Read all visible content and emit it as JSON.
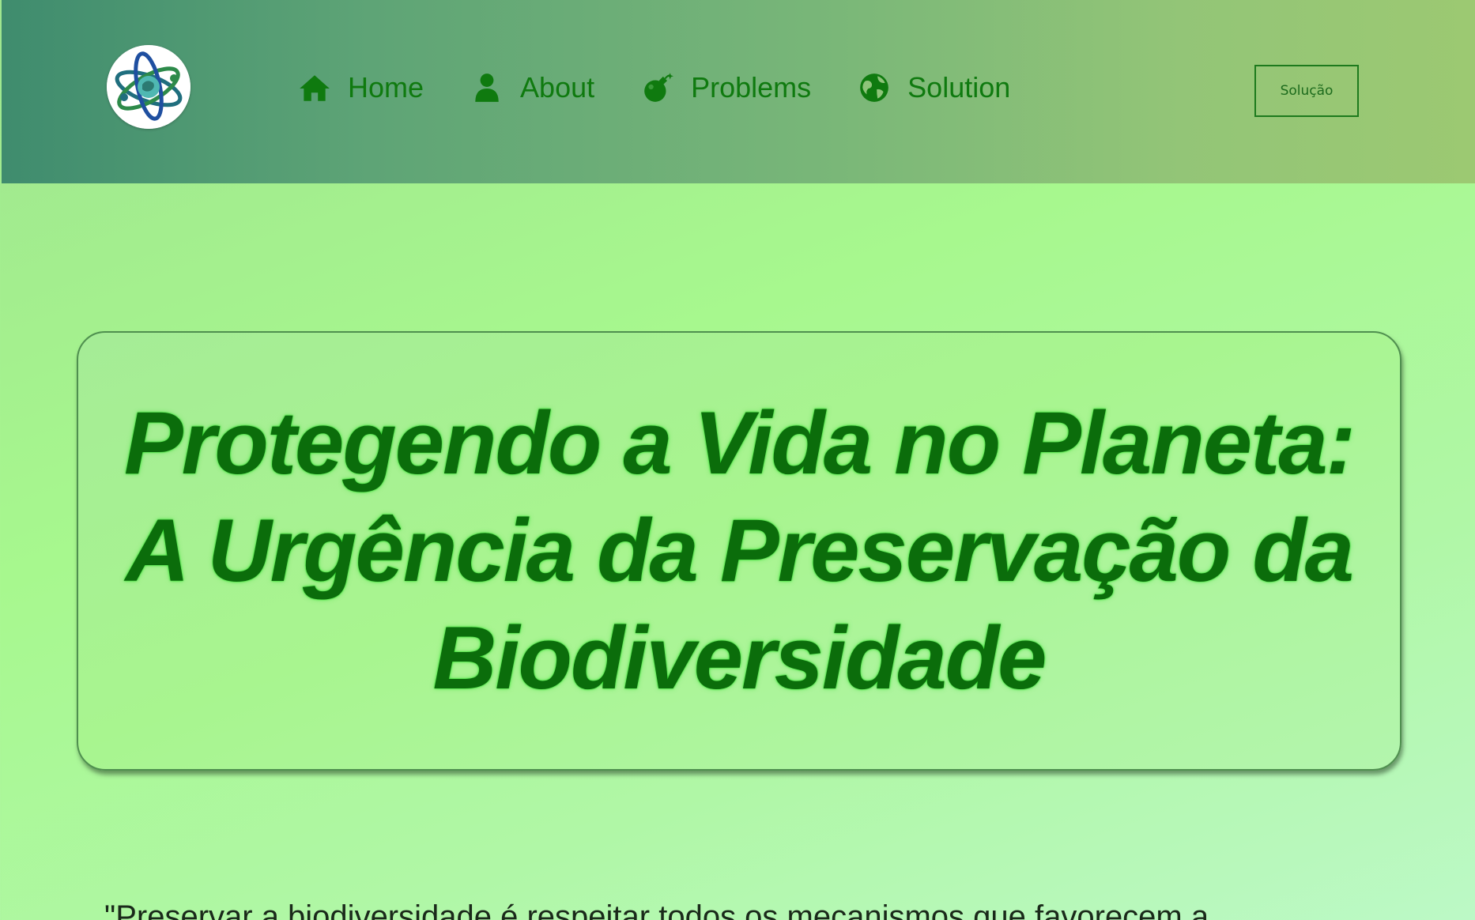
{
  "header": {
    "logo_alt": "Logo",
    "nav": [
      {
        "label": "Home",
        "icon": "home-icon"
      },
      {
        "label": "About",
        "icon": "user-icon"
      },
      {
        "label": "Problems",
        "icon": "bomb-icon"
      },
      {
        "label": "Solution",
        "icon": "globe-icon"
      }
    ],
    "cta_label": "Solução"
  },
  "hero": {
    "title": "Protegendo a Vida no Planeta: A Urgência da Preservação da Biodiversidade"
  },
  "quote": {
    "text": "\"Preservar a biodiversidade é respeitar todos os mecanismos que favorecem a"
  },
  "colors": {
    "header_gradient_start": "#3f8c6e",
    "header_gradient_end": "#9cc972",
    "nav_text": "#0f7a0f",
    "title_text": "#0b6d0b",
    "page_background": "#a7f88e"
  }
}
